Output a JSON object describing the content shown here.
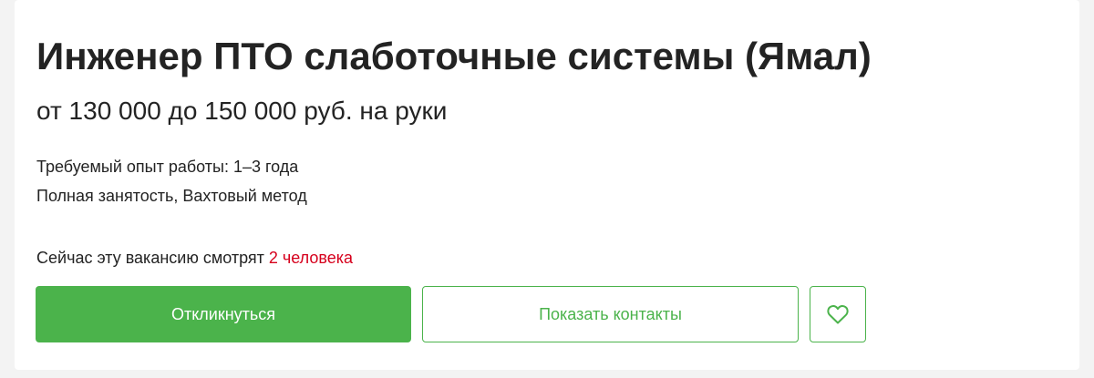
{
  "vacancy": {
    "title": "Инженер ПТО слаботочные системы (Ямал)",
    "salary": "от 130 000 до 150 000 руб. на руки",
    "experience": "Требуемый опыт работы: 1–3 года",
    "employment": "Полная занятость, Вахтовый метод",
    "viewers_prefix": "Сейчас эту вакансию смотрят ",
    "viewers_count": "2 человека"
  },
  "actions": {
    "respond_label": "Откликнуться",
    "contacts_label": "Показать контакты",
    "favorite_icon": "heart-icon"
  },
  "colors": {
    "accent": "#4bb34b",
    "viewers_highlight": "#d6001c",
    "text": "#232323"
  }
}
